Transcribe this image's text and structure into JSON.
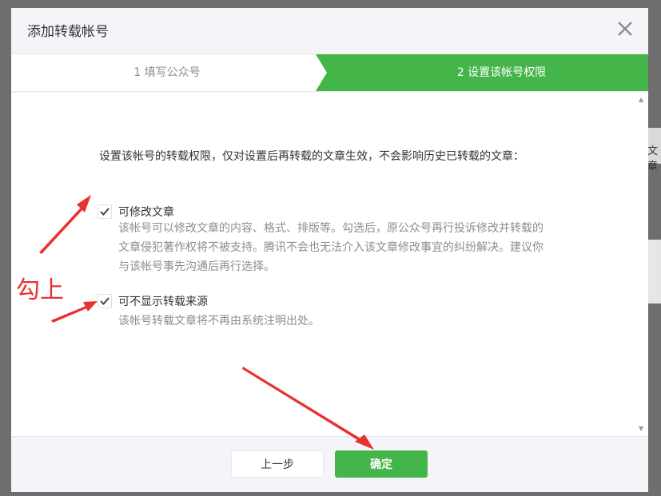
{
  "background": {
    "right_edge_text": "文章"
  },
  "dialog": {
    "title": "添加转载帐号",
    "close_icon": "close-x-icon"
  },
  "steps": [
    {
      "label": "1 填写公众号",
      "active": false
    },
    {
      "label": "2 设置该帐号权限",
      "active": true
    }
  ],
  "content": {
    "intro": "设置该帐号的转载权限，仅对设置后再转载的文章生效，不会影响历史已转载的文章：",
    "options": [
      {
        "label": "可修改文章",
        "checked": true,
        "description": "该帐号可以修改文章的内容、格式、排版等。勾选后，原公众号再行投诉修改并转载的文章侵犯著作权将不被支持。腾讯不会也无法介入该文章修改事宜的纠纷解决。建议你与该帐号事先沟通后再行选择。"
      },
      {
        "label": "可不显示转载来源",
        "checked": true,
        "description": "该帐号转载文章将不再由系统注明出处。"
      }
    ]
  },
  "footer": {
    "prev_label": "上一步",
    "confirm_label": "确定"
  },
  "annotation": {
    "text": "勾上",
    "color": "#e8322f"
  },
  "colors": {
    "accent_green": "#44b549",
    "muted_text": "#8d8d8d"
  }
}
